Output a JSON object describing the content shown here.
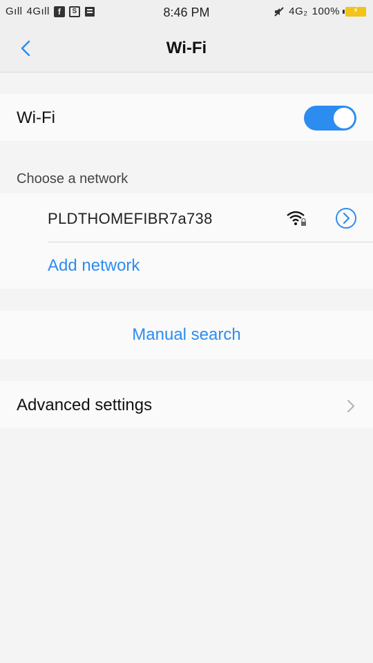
{
  "status_bar": {
    "signal1": "Gıll",
    "signal2": "4Gıll",
    "app_icon_a": "f",
    "app_icon_b": "S",
    "time": "8:46 PM",
    "network_type": "4G₂",
    "battery": "100%"
  },
  "header": {
    "title": "Wi-Fi",
    "back_icon": "chevron-left-icon"
  },
  "wifi_toggle": {
    "label": "Wi-Fi",
    "state": "on",
    "color": "#2d8cf0"
  },
  "networks": {
    "header": "Choose a network",
    "items": [
      {
        "name": "PLDTHOMEFIBR7a738",
        "secured": true,
        "icon": "wifi-lock-icon"
      }
    ],
    "add_label": "Add network"
  },
  "manual_search": {
    "label": "Manual search"
  },
  "advanced": {
    "label": "Advanced settings"
  },
  "colors": {
    "accent": "#2d8cf0",
    "background": "#f4f4f4"
  }
}
